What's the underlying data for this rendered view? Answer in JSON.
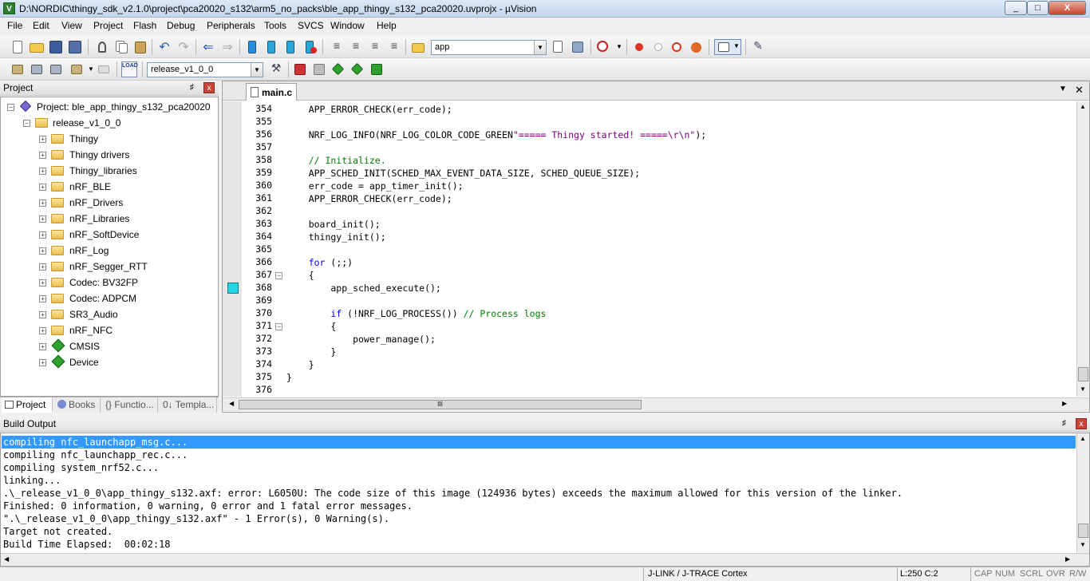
{
  "window": {
    "title": "D:\\NORDIC\\thingy_sdk_v2.1.0\\project\\pca20020_s132\\arm5_no_packs\\ble_app_thingy_s132_pca20020.uvprojx - µVision",
    "icon_letter": "V",
    "min": "_",
    "max": "□",
    "close": "X"
  },
  "menu": [
    "File",
    "Edit",
    "View",
    "Project",
    "Flash",
    "Debug",
    "Peripherals",
    "Tools",
    "SVCS",
    "Window",
    "Help"
  ],
  "toolbar": {
    "find_value": "app",
    "target_value": "release_v1_0_0",
    "load_label": "LOAD"
  },
  "project_panel": {
    "title": "Project",
    "pin": "♯",
    "close": "x",
    "root": "Project: ble_app_thingy_s132_pca20020",
    "target": "release_v1_0_0",
    "groups": [
      "Thingy",
      "Thingy drivers",
      "Thingy_libraries",
      "nRF_BLE",
      "nRF_Drivers",
      "nRF_Libraries",
      "nRF_SoftDevice",
      "nRF_Log",
      "nRF_Segger_RTT",
      "Codec: BV32FP",
      "Codec: ADPCM",
      "SR3_Audio",
      "nRF_NFC"
    ],
    "components": [
      "CMSIS",
      "Device"
    ],
    "tabs": [
      "Project",
      "Books",
      "{} Functio...",
      "0↓ Templa..."
    ]
  },
  "editor": {
    "file_tab": "main.c",
    "tab_menu": "▼",
    "tab_close": "✕",
    "lines": [
      {
        "n": "354",
        "code": "    APP_ERROR_CHECK(err_code);"
      },
      {
        "n": "355",
        "code": ""
      },
      {
        "n": "356",
        "code_a": "    NRF_LOG_INFO(NRF_LOG_COLOR_CODE_GREEN",
        "code_str": "\"===== Thingy started! =====\\r\\n\"",
        "code_b": ");"
      },
      {
        "n": "357",
        "code": ""
      },
      {
        "n": "358",
        "comment": "    // Initialize."
      },
      {
        "n": "359",
        "code": "    APP_SCHED_INIT(SCHED_MAX_EVENT_DATA_SIZE, SCHED_QUEUE_SIZE);"
      },
      {
        "n": "360",
        "code": "    err_code = app_timer_init();"
      },
      {
        "n": "361",
        "code": "    APP_ERROR_CHECK(err_code);"
      },
      {
        "n": "362",
        "code": ""
      },
      {
        "n": "363",
        "code": "    board_init();"
      },
      {
        "n": "364",
        "code": "    thingy_init();"
      },
      {
        "n": "365",
        "code": ""
      },
      {
        "n": "366",
        "kw": "    for",
        "code": " (;;)"
      },
      {
        "n": "367",
        "code": "    {"
      },
      {
        "n": "368",
        "code": "        app_sched_execute();"
      },
      {
        "n": "369",
        "code": ""
      },
      {
        "n": "370",
        "kw": "        if",
        "code": " (!NRF_LOG_PROCESS()) ",
        "comment": "// Process logs"
      },
      {
        "n": "371",
        "code": "        {"
      },
      {
        "n": "372",
        "code": "            power_manage();"
      },
      {
        "n": "373",
        "code": "        }"
      },
      {
        "n": "374",
        "code": "    }"
      },
      {
        "n": "375",
        "code": "}"
      },
      {
        "n": "376",
        "code": ""
      }
    ],
    "hscroll_thumb": "III"
  },
  "build_output": {
    "title": "Build Output",
    "lines": [
      "compiling nfc_launchapp_msg.c...",
      "compiling nfc_launchapp_rec.c...",
      "compiling system_nrf52.c...",
      "linking...",
      ".\\_release_v1_0_0\\app_thingy_s132.axf: error: L6050U: The code size of this image (124936 bytes) exceeds the maximum allowed for this version of the linker.",
      "Finished: 0 information, 0 warning, 0 error and 1 fatal error messages.",
      "\".\\_release_v1_0_0\\app_thingy_s132.axf\" - 1 Error(s), 0 Warning(s).",
      "Target not created.",
      "Build Time Elapsed:  00:02:18"
    ]
  },
  "status": {
    "debugger": "J-LINK / J-TRACE Cortex",
    "position": "L:250 C:2",
    "cap": "CAP",
    "num": "NUM",
    "scrl": "SCRL",
    "ovr": "OVR",
    "rw": "R/W"
  },
  "colors": {
    "keyword": "#0000ff",
    "comment": "#008000",
    "string": "#800080",
    "selection": "#3399ff",
    "bookmark": "#25d5e3"
  }
}
